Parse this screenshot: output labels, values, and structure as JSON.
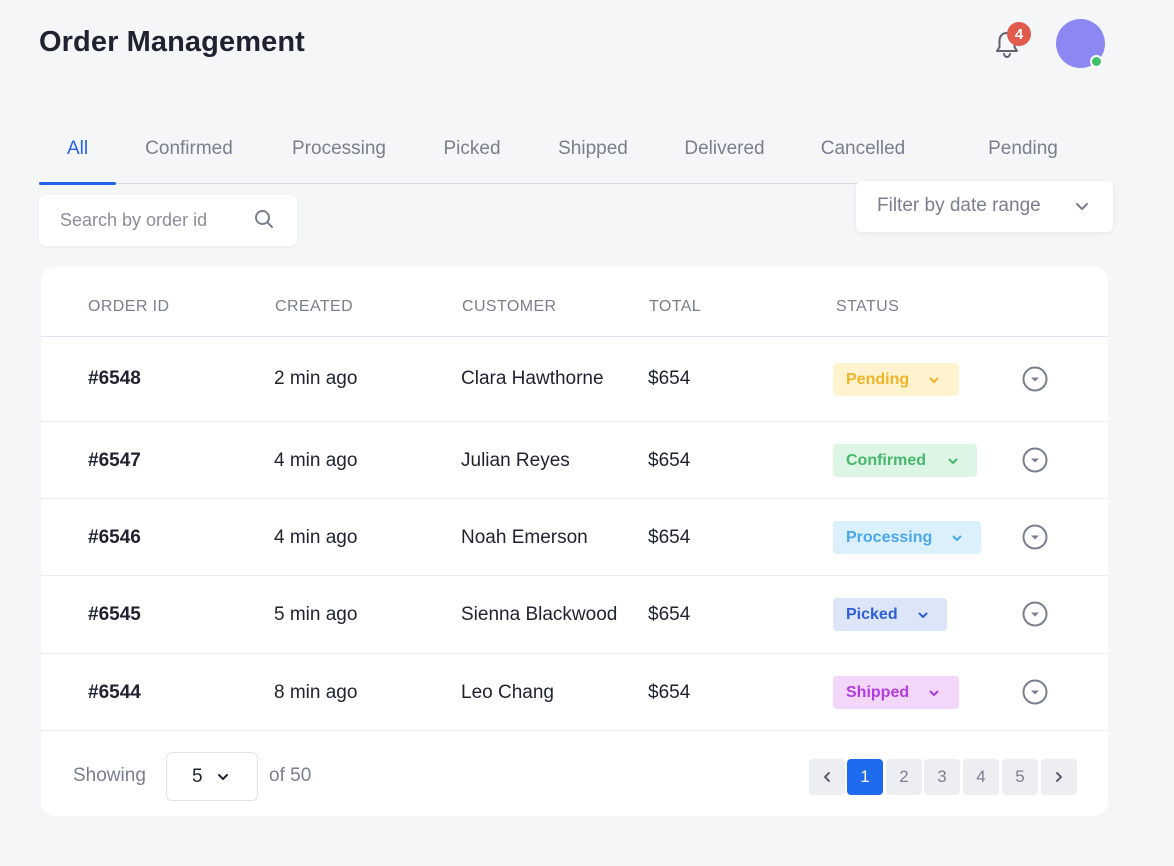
{
  "header": {
    "title": "Order Management",
    "notification_count": "4"
  },
  "tabs": [
    {
      "label": "All",
      "active": true
    },
    {
      "label": "Confirmed"
    },
    {
      "label": "Processing"
    },
    {
      "label": "Picked"
    },
    {
      "label": "Shipped"
    },
    {
      "label": "Delivered"
    },
    {
      "label": "Cancelled"
    },
    {
      "label": "Pending"
    }
  ],
  "search": {
    "placeholder": "Search by order id",
    "value": ""
  },
  "date_filter": {
    "label": "Filter by date range"
  },
  "table": {
    "columns": [
      "ORDER ID",
      "CREATED",
      "CUSTOMER",
      "TOTAL",
      "STATUS"
    ],
    "rows": [
      {
        "id": "#6548",
        "created": "2 min ago",
        "customer": "Clara Hawthorne",
        "total": "$654",
        "status": "Pending"
      },
      {
        "id": "#6547",
        "created": "4 min ago",
        "customer": "Julian Reyes",
        "total": "$654",
        "status": "Confirmed"
      },
      {
        "id": "#6546",
        "created": "4 min ago",
        "customer": "Noah Emerson",
        "total": "$654",
        "status": "Processing"
      },
      {
        "id": "#6545",
        "created": "5 min ago",
        "customer": "Sienna Blackwood",
        "total": "$654",
        "status": "Picked"
      },
      {
        "id": "#6544",
        "created": "8 min ago",
        "customer": "Leo Chang",
        "total": "$654",
        "status": "Shipped"
      }
    ]
  },
  "status_colors": {
    "Pending": {
      "bg": "#fdf3cf",
      "fg": "#f0b429"
    },
    "Confirmed": {
      "bg": "#dcf5e4",
      "fg": "#46b86b"
    },
    "Processing": {
      "bg": "#dcf0fc",
      "fg": "#4aa8e8"
    },
    "Picked": {
      "bg": "#dde5f8",
      "fg": "#2f5fd8"
    },
    "Shipped": {
      "bg": "#f2d7fb",
      "fg": "#b23ce0"
    }
  },
  "footer": {
    "showing_label": "Showing",
    "page_size": "5",
    "of_label": "of 50",
    "pages": [
      "1",
      "2",
      "3",
      "4",
      "5"
    ],
    "current_page": "1"
  },
  "colors": {
    "accent": "#2563eb",
    "background": "#f5f6f8"
  }
}
